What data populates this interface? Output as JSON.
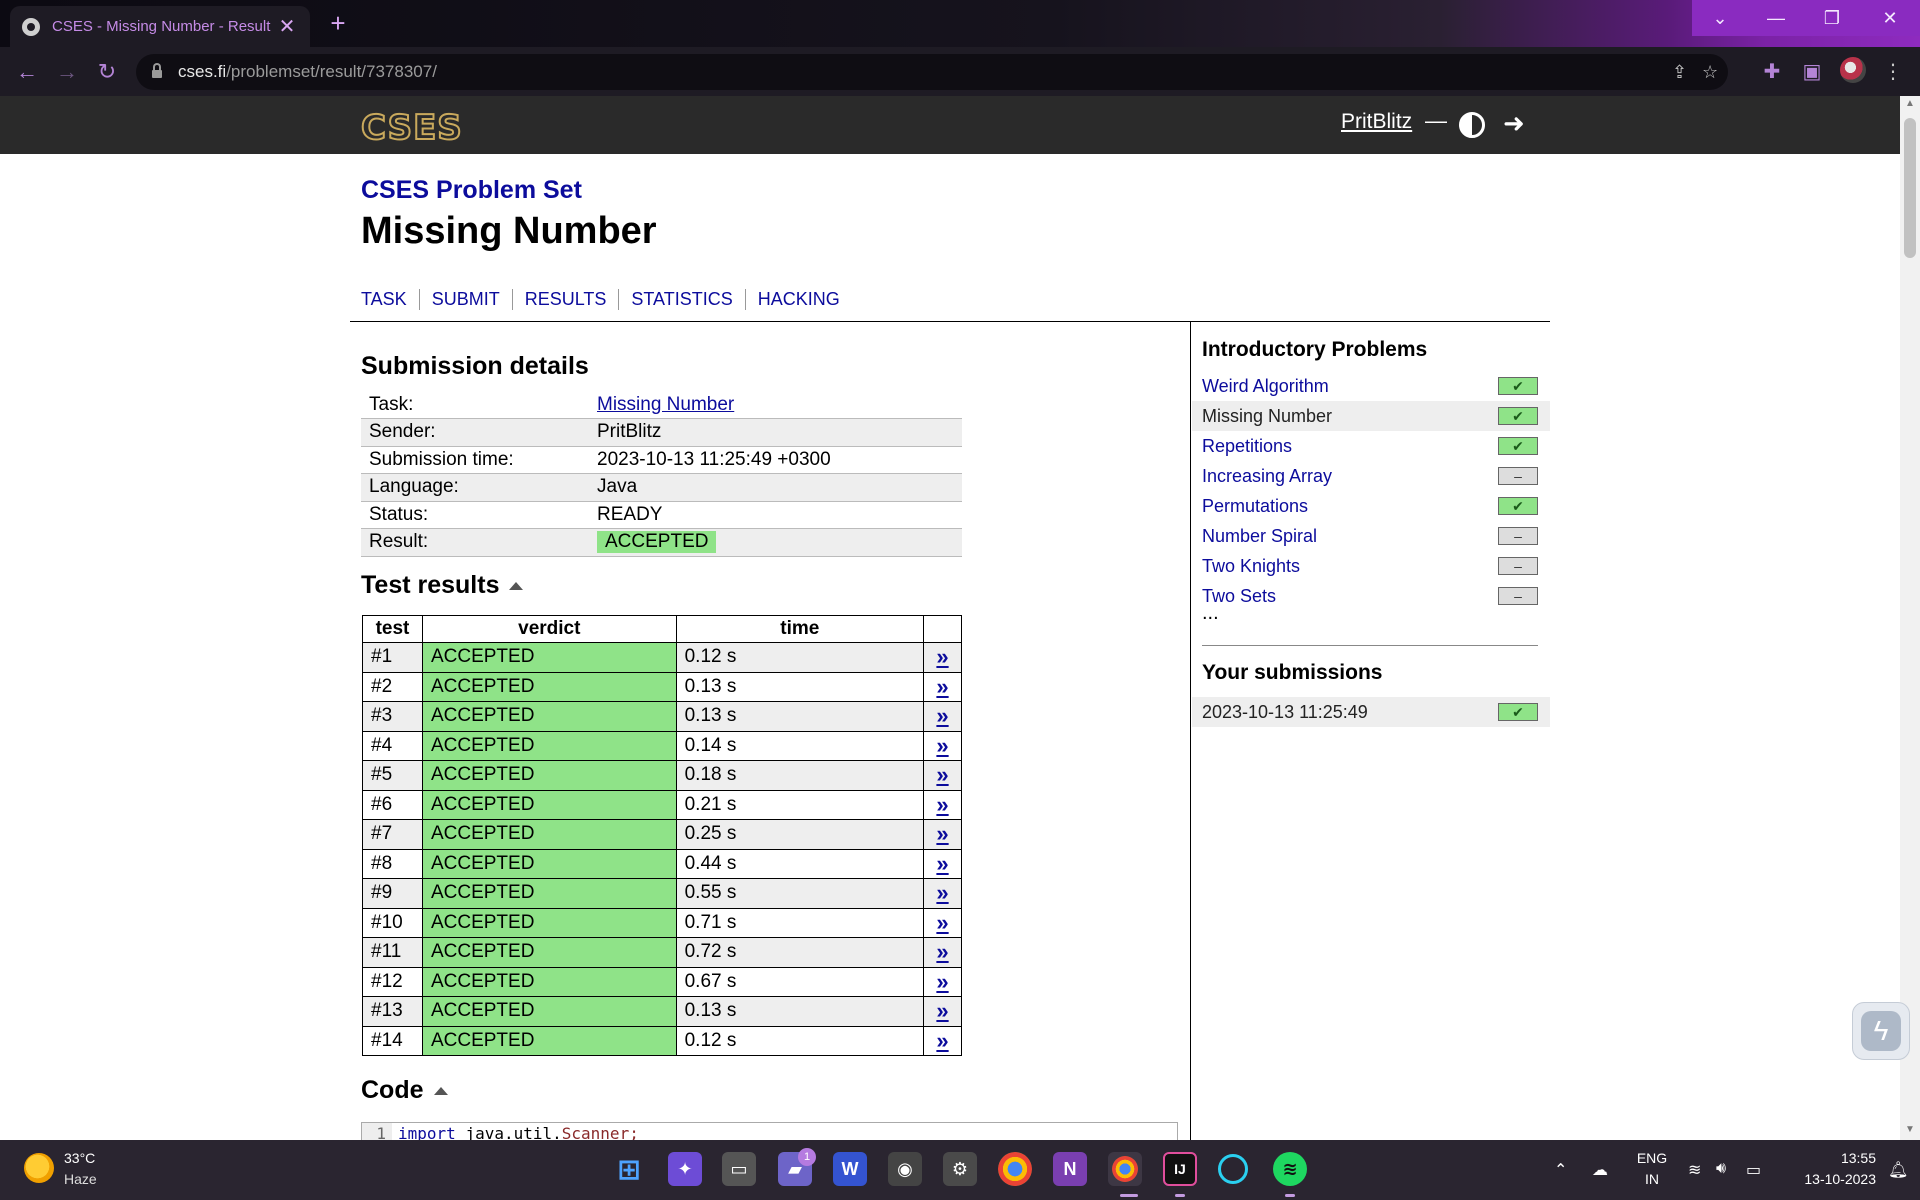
{
  "browser": {
    "tab_title": "CSES - Missing Number - Result",
    "tab_close": "✕",
    "new_tab": "+",
    "url_host": "cses.fi",
    "url_path": "/problemset/result/7378307/",
    "win_controls": [
      "⌄",
      "—",
      "❐",
      "✕"
    ]
  },
  "site": {
    "logo": "CSES",
    "user": "PritBlitz",
    "dash": "—"
  },
  "page": {
    "crumb": "CSES Problem Set",
    "title": "Missing Number",
    "nav": [
      "TASK",
      "SUBMIT",
      "RESULTS",
      "STATISTICS",
      "HACKING"
    ]
  },
  "details": {
    "heading": "Submission details",
    "rows": [
      {
        "label": "Task:",
        "value": "Missing Number"
      },
      {
        "label": "Sender:",
        "value": "PritBlitz"
      },
      {
        "label": "Submission time:",
        "value": "2023-10-13 11:25:49 +0300"
      },
      {
        "label": "Language:",
        "value": "Java"
      },
      {
        "label": "Status:",
        "value": "READY"
      },
      {
        "label": "Result:",
        "value": "ACCEPTED"
      }
    ]
  },
  "tests": {
    "heading": "Test results",
    "headers": [
      "test",
      "verdict",
      "time"
    ],
    "arrow": "»",
    "rows": [
      {
        "test": "#1",
        "verdict": "ACCEPTED",
        "time": "0.12 s"
      },
      {
        "test": "#2",
        "verdict": "ACCEPTED",
        "time": "0.13 s"
      },
      {
        "test": "#3",
        "verdict": "ACCEPTED",
        "time": "0.13 s"
      },
      {
        "test": "#4",
        "verdict": "ACCEPTED",
        "time": "0.14 s"
      },
      {
        "test": "#5",
        "verdict": "ACCEPTED",
        "time": "0.18 s"
      },
      {
        "test": "#6",
        "verdict": "ACCEPTED",
        "time": "0.21 s"
      },
      {
        "test": "#7",
        "verdict": "ACCEPTED",
        "time": "0.25 s"
      },
      {
        "test": "#8",
        "verdict": "ACCEPTED",
        "time": "0.44 s"
      },
      {
        "test": "#9",
        "verdict": "ACCEPTED",
        "time": "0.55 s"
      },
      {
        "test": "#10",
        "verdict": "ACCEPTED",
        "time": "0.71 s"
      },
      {
        "test": "#11",
        "verdict": "ACCEPTED",
        "time": "0.72 s"
      },
      {
        "test": "#12",
        "verdict": "ACCEPTED",
        "time": "0.67 s"
      },
      {
        "test": "#13",
        "verdict": "ACCEPTED",
        "time": "0.13 s"
      },
      {
        "test": "#14",
        "verdict": "ACCEPTED",
        "time": "0.12 s"
      }
    ]
  },
  "code": {
    "heading": "Code",
    "line_no": "1",
    "keyword": "import",
    "text": " java.util.",
    "cls": "Scanner;"
  },
  "sidebar": {
    "heading": "Introductory Problems",
    "problems": [
      {
        "name": "Weird Algorithm",
        "status": "solved",
        "current": false
      },
      {
        "name": "Missing Number",
        "status": "solved",
        "current": true
      },
      {
        "name": "Repetitions",
        "status": "solved",
        "current": false
      },
      {
        "name": "Increasing Array",
        "status": "unsolved",
        "current": false
      },
      {
        "name": "Permutations",
        "status": "solved",
        "current": false
      },
      {
        "name": "Number Spiral",
        "status": "unsolved",
        "current": false
      },
      {
        "name": "Two Knights",
        "status": "unsolved",
        "current": false
      },
      {
        "name": "Two Sets",
        "status": "unsolved",
        "current": false
      }
    ],
    "more": "...",
    "subs_heading": "Your submissions",
    "submissions": [
      {
        "time": "2023-10-13 11:25:49",
        "status": "solved"
      }
    ]
  },
  "taskbar": {
    "temp": "33°C",
    "condition": "Haze",
    "chat_badge": "1",
    "lang_top": "ENG",
    "lang_bottom": "IN",
    "time": "13:55",
    "date": "13-10-2023"
  },
  "colors": {
    "accepted_green": "#8fe388",
    "link_blue": "#0c0c9c",
    "header_bg": "#2a2a2a",
    "logo_gold": "#c9a95c"
  }
}
